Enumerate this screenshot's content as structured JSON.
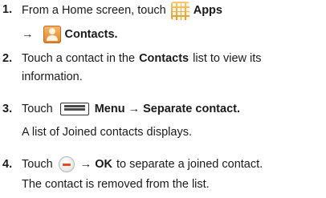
{
  "steps": [
    {
      "number": "1.",
      "lines": [
        [
          "From a Home screen, touch",
          "Apps"
        ],
        [
          "→",
          "Contacts."
        ]
      ]
    },
    {
      "number": "2.",
      "lines": [
        [
          "Touch a contact in the",
          "Contacts",
          "list to view its"
        ],
        [
          "information."
        ]
      ]
    },
    {
      "number": "3.",
      "lines": [
        [
          "Touch",
          "Menu → Separate contact."
        ],
        [
          "A list of Joined contacts displays."
        ]
      ]
    },
    {
      "number": "4.",
      "lines": [
        [
          "Touch",
          "→ OK",
          "to separate a joined contact."
        ],
        [
          "The contact is removed from the list."
        ]
      ]
    }
  ],
  "icons": {
    "apps": "apps-grid-icon",
    "contacts": "contacts-person-icon",
    "menu": "menu-key-icon",
    "remove": "minus-circle-icon"
  }
}
